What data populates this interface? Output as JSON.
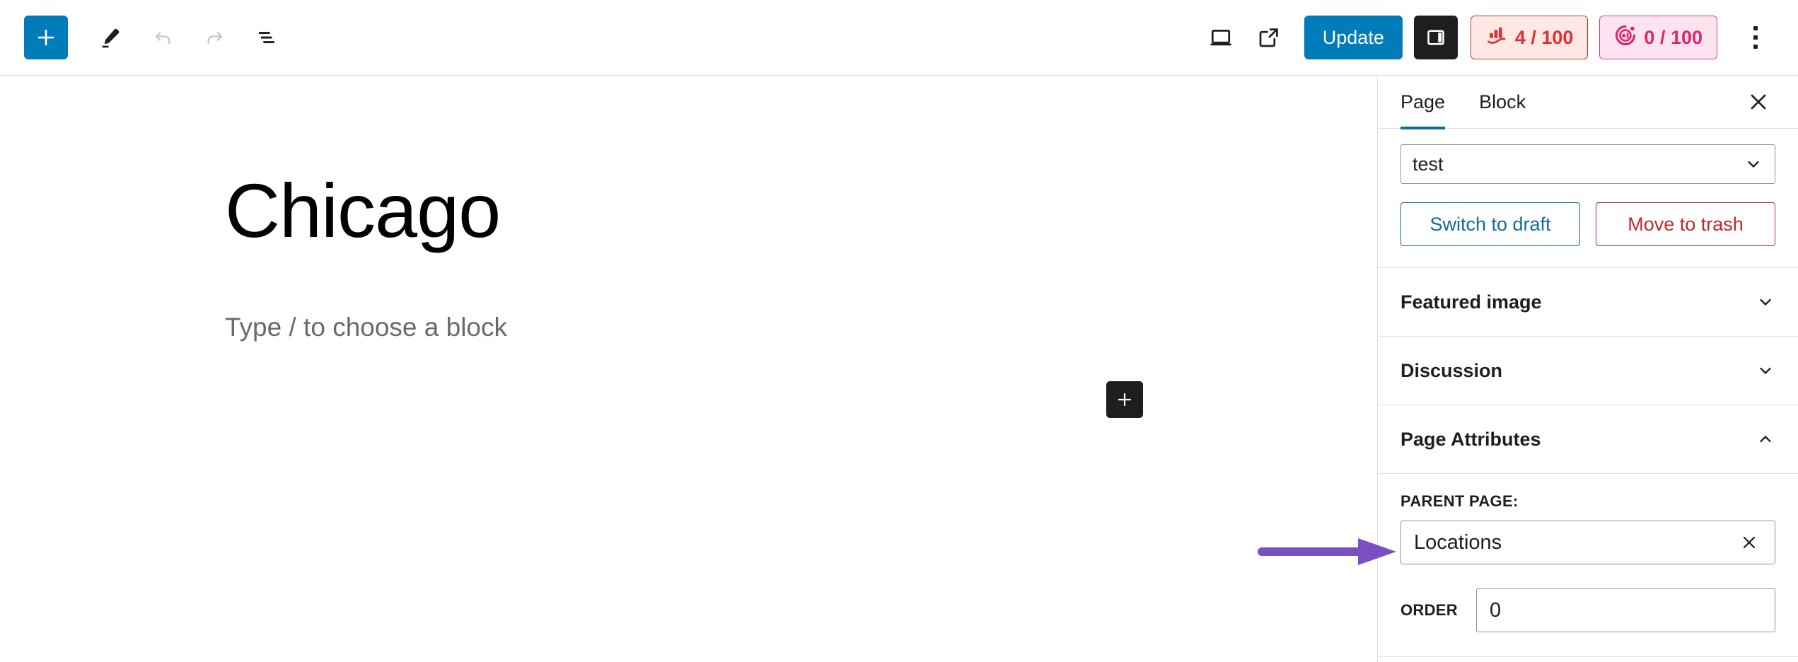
{
  "header": {
    "add_block_label": "+",
    "tools": [
      {
        "name": "add-block",
        "label": "Add block"
      },
      {
        "name": "edit-mode",
        "label": "Edit"
      },
      {
        "name": "undo",
        "label": "Undo"
      },
      {
        "name": "redo",
        "label": "Redo"
      },
      {
        "name": "list-view",
        "label": "Document Overview"
      }
    ],
    "preview_label": "View",
    "view_page_label": "View page",
    "update_label": "Update",
    "settings_toggle_label": "Settings",
    "seo_badge": {
      "score": "4 / 100",
      "icon": "seo-bar-chart-icon",
      "text_color": "#e03030",
      "bg_color": "#fde8e4",
      "border_color": "#c0392b"
    },
    "ai_badge": {
      "score": "0 / 100",
      "icon": "ai-circle-icon",
      "text_color": "#e0246f",
      "bg_color": "#fce4ef",
      "border_color": "#cf4392"
    },
    "options_label": "Options",
    "accent_blue": "#007cba"
  },
  "canvas": {
    "title": "Chicago",
    "block_placeholder": "Type / to choose a block",
    "add_block_label": "Add block"
  },
  "annotation": {
    "arrow_color": "#7a4fc0",
    "points_to": "parent-page-input"
  },
  "sidebar": {
    "tabs": [
      {
        "label": "Page",
        "active": true
      },
      {
        "label": "Block",
        "active": false
      }
    ],
    "close_label": "Close settings",
    "status": {
      "value": "test",
      "options": [
        "test"
      ],
      "switch_to_draft_label": "Switch to draft",
      "move_to_trash_label": "Move to trash"
    },
    "panels": [
      {
        "title": "Featured image",
        "expanded": false
      },
      {
        "title": "Discussion",
        "expanded": false
      },
      {
        "title": "Page Attributes",
        "expanded": true
      }
    ],
    "page_attributes": {
      "parent_label": "PARENT PAGE:",
      "parent_value": "Locations",
      "parent_clear_label": "Clear",
      "order_label": "ORDER",
      "order_value": "0"
    }
  }
}
